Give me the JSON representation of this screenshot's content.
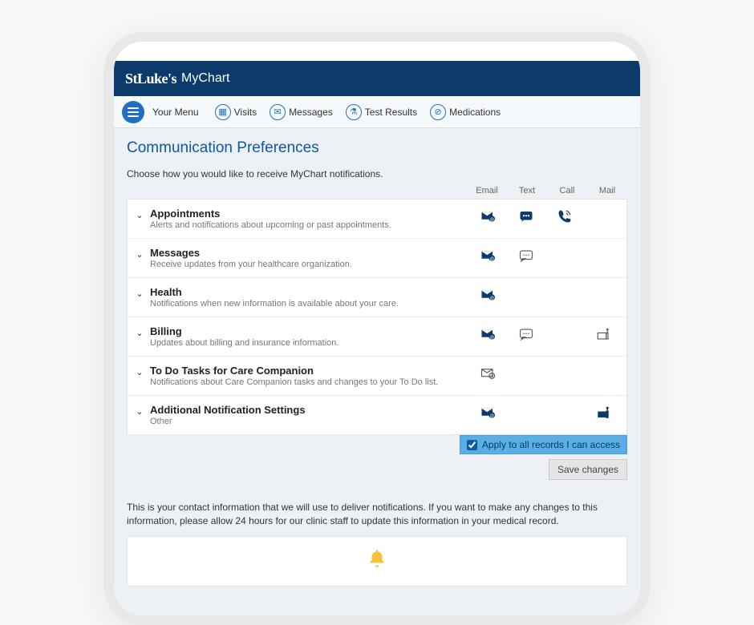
{
  "brand": {
    "name": "StLuke's",
    "app": "MyChart"
  },
  "nav": {
    "menu_label": "Your Menu",
    "items": [
      {
        "icon": "calendar",
        "label": "Visits"
      },
      {
        "icon": "mail",
        "label": "Messages"
      },
      {
        "icon": "flask",
        "label": "Test Results"
      },
      {
        "icon": "pill",
        "label": "Medications"
      }
    ]
  },
  "page": {
    "title": "Communication Preferences",
    "instruction": "Choose how you would like to receive MyChart notifications.",
    "columns": [
      "Email",
      "Text",
      "Call",
      "Mail"
    ]
  },
  "sections": [
    {
      "title": "Appointments",
      "desc": "Alerts and notifications about upcoming or past appointments.",
      "email": "on",
      "text": "on",
      "call": "on",
      "mail": null
    },
    {
      "title": "Messages",
      "desc": "Receive updates from your healthcare organization.",
      "email": "on",
      "text": "off",
      "call": null,
      "mail": null
    },
    {
      "title": "Health",
      "desc": "Notifications when new information is available about your care.",
      "email": "on",
      "text": null,
      "call": null,
      "mail": null
    },
    {
      "title": "Billing",
      "desc": "Updates about billing and insurance information.",
      "email": "on",
      "text": "off",
      "call": null,
      "mail": "off"
    },
    {
      "title": "To Do Tasks for Care Companion",
      "desc": "Notifications about Care Companion tasks and changes to your To Do list.",
      "email": "off",
      "text": null,
      "call": null,
      "mail": null
    },
    {
      "title": "Additional Notification Settings",
      "desc": "Other",
      "email": "on",
      "text": null,
      "call": null,
      "mail": "on"
    }
  ],
  "apply": {
    "label": "Apply to all records I can access",
    "checked": true
  },
  "save": {
    "label": "Save changes"
  },
  "contact_note": "This is your contact information that we will use to deliver notifications. If you want to make any changes to this information, please allow 24 hours for our clinic staff to update this information in your medical record."
}
